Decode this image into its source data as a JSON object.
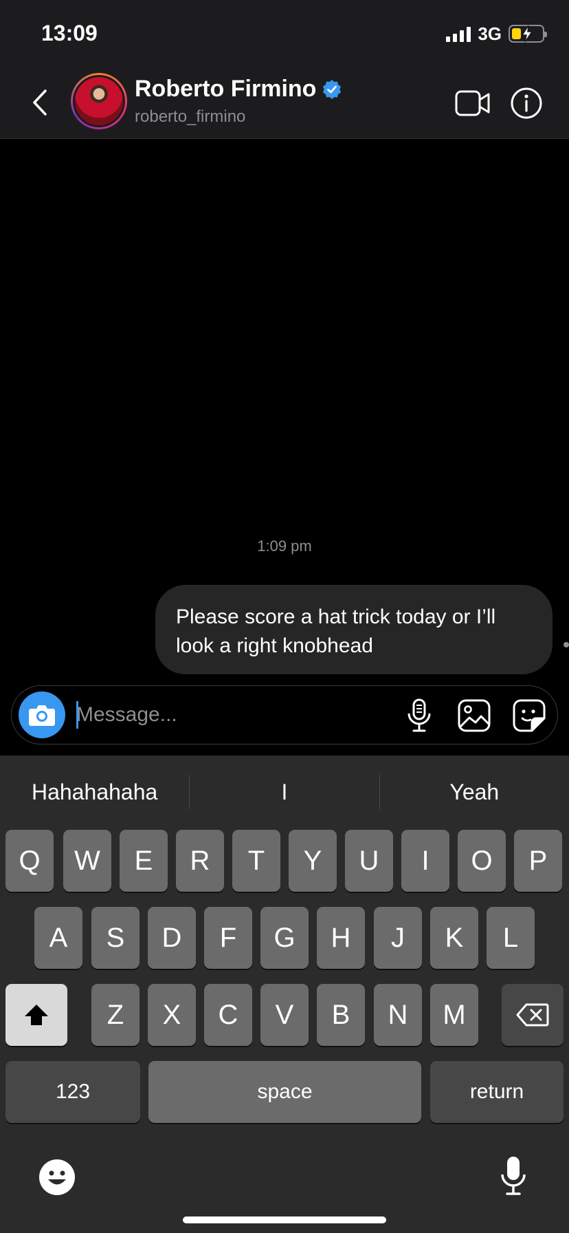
{
  "status_bar": {
    "time": "13:09",
    "network": "3G"
  },
  "header": {
    "name": "Roberto Firmino",
    "username": "roberto_firmino",
    "back_icon": "chevron-left-icon",
    "video_icon": "video-call-icon",
    "info_icon": "info-icon",
    "verified_color": "#3897f0"
  },
  "chat": {
    "timestamp": "1:09 pm",
    "messages": [
      {
        "sender": "me",
        "text_lines": [
          "Please score a hat trick today or I’ll",
          "look a right knobhead"
        ]
      }
    ]
  },
  "composer": {
    "placeholder": "Message...",
    "icons": [
      "camera-icon",
      "microphone-icon",
      "gallery-icon",
      "sticker-icon"
    ],
    "camera_color": "#3897f0"
  },
  "keyboard": {
    "suggestions": [
      "Hahahahaha",
      "I",
      "Yeah"
    ],
    "row1": [
      "Q",
      "W",
      "E",
      "R",
      "T",
      "Y",
      "U",
      "I",
      "O",
      "P"
    ],
    "row2": [
      "A",
      "S",
      "D",
      "F",
      "G",
      "H",
      "J",
      "K",
      "L"
    ],
    "row3": [
      "Z",
      "X",
      "C",
      "V",
      "B",
      "N",
      "M"
    ],
    "numbers_label": "123",
    "space_label": "space",
    "return_label": "return",
    "shift_icon": "shift-icon",
    "delete_icon": "backspace-icon",
    "emoji_icon": "emoji-icon",
    "dictation_icon": "microphone-icon"
  }
}
